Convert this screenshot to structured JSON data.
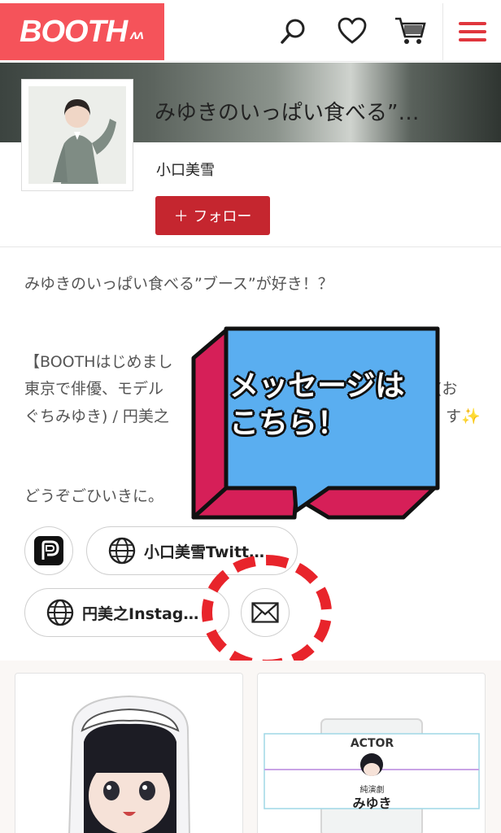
{
  "header": {
    "logo": "BOOTH",
    "icons": [
      "search-icon",
      "heart-icon",
      "cart-icon",
      "hamburger-menu-icon"
    ],
    "accent_color": "#f5535a"
  },
  "shop": {
    "title": "みゆきのいっぱい食べる”…",
    "owner_name": "小口美雪",
    "follow_label": "＋ フォロー",
    "follow_color": "#c5262f"
  },
  "description": {
    "line1": "みゆきのいっぱい食べる”ブース”が好き！？",
    "line2": "【BOOTHはじめまし",
    "line3": "東京で俳優、モデル",
    "line3_tail": "(お",
    "line4": "ぐちみゆき) / 円美之",
    "line4_tail": "す✨",
    "line5": "どうぞごひいきに。"
  },
  "links": {
    "pixiv_icon": "pixiv-fanbox-icon",
    "twitter_label": "小口美雪Twitt…",
    "instagram_label": "円美之Instag…",
    "message_icon": "envelope-icon"
  },
  "overlay": {
    "bubble_line1": "メッセージは",
    "bubble_line2": "こちら！"
  },
  "products": [
    {
      "image": "maid-cushion-illustration"
    },
    {
      "image": "actor-cup-illustration",
      "label_top": "ACTOR",
      "label_sub": "純演劇",
      "label_name": "みゆき"
    }
  ]
}
